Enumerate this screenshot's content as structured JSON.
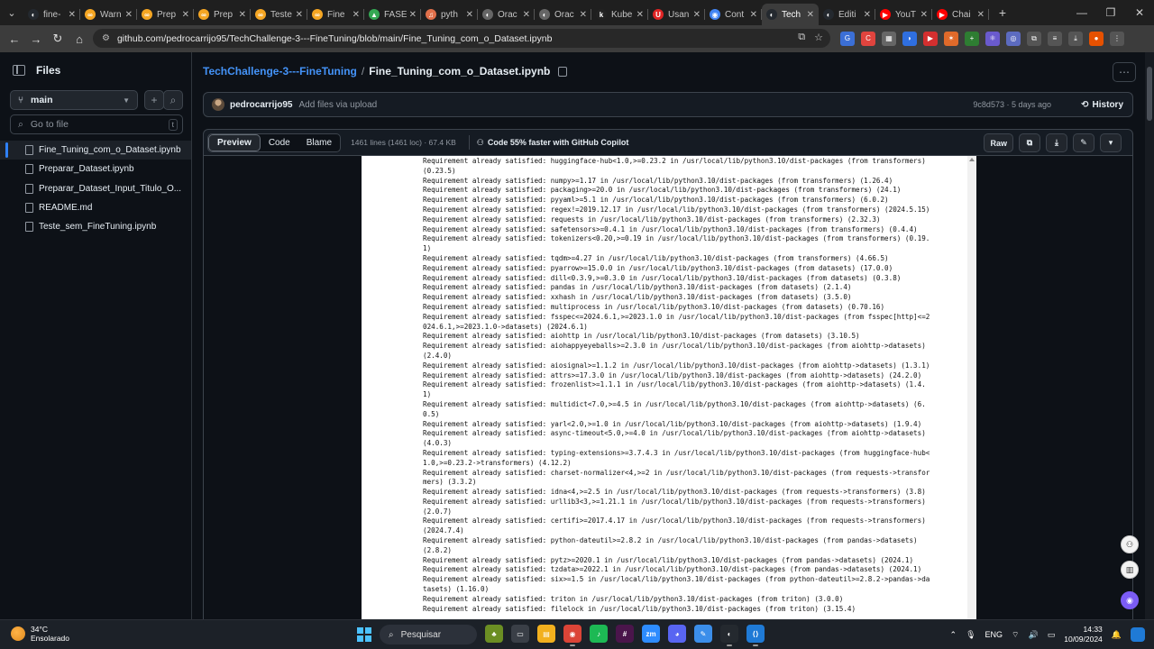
{
  "browser": {
    "tabs": [
      {
        "label": "fine-",
        "color": "#24292f",
        "glyph": "◐"
      },
      {
        "label": "Warn",
        "color": "#f5a623",
        "glyph": "∞"
      },
      {
        "label": "Prep",
        "color": "#f5a623",
        "glyph": "∞"
      },
      {
        "label": "Prep",
        "color": "#f5a623",
        "glyph": "∞"
      },
      {
        "label": "Teste",
        "color": "#f5a623",
        "glyph": "∞"
      },
      {
        "label": "Fine",
        "color": "#f5a623",
        "glyph": "∞"
      },
      {
        "label": "FASE",
        "color": "#34a853",
        "glyph": "▲"
      },
      {
        "label": "pyth",
        "color": "#e1704b",
        "glyph": "♫"
      },
      {
        "label": "Orac",
        "color": "#666666",
        "glyph": "◐"
      },
      {
        "label": "Orac",
        "color": "#666666",
        "glyph": "◐"
      },
      {
        "label": "Kube",
        "color": "#222222",
        "glyph": "k"
      },
      {
        "label": "Usan",
        "color": "#e02424",
        "glyph": "U"
      },
      {
        "label": "Cont",
        "color": "#4285f4",
        "glyph": "◉"
      },
      {
        "label": "Tech",
        "color": "#24292f",
        "glyph": "◐",
        "active": true
      },
      {
        "label": "Editi",
        "color": "#24292f",
        "glyph": "◐"
      },
      {
        "label": "YouT",
        "color": "#ff0000",
        "glyph": "▶"
      },
      {
        "label": "Chai",
        "color": "#ff0000",
        "glyph": "▶"
      }
    ],
    "close_glyph": "✕",
    "new_tab_glyph": "+",
    "url": "github.com/pedrocarrijo95/TechChallenge-3---FineTuning/blob/main/Fine_Tuning_com_o_Dataset.ipynb",
    "window_controls": {
      "minimize": "—",
      "restore": "❐",
      "close": "✕"
    },
    "nav": {
      "back": "←",
      "forward": "→",
      "reload": "↻",
      "home": "⌂"
    },
    "omni_icon": "⚙",
    "omni_actions": {
      "install": "⧉",
      "bookmark": "☆"
    },
    "extensions": [
      {
        "color": "#3b6fd6",
        "glyph": "G"
      },
      {
        "color": "#e0443e",
        "glyph": "C"
      },
      {
        "color": "#666666",
        "glyph": "▦"
      },
      {
        "color": "#2f6fe0",
        "glyph": "◗"
      },
      {
        "color": "#d32f2f",
        "glyph": "▶"
      },
      {
        "color": "#e06a2a",
        "glyph": "✶"
      },
      {
        "color": "#2e7d32",
        "glyph": "+"
      },
      {
        "color": "#6a5acd",
        "glyph": "⚛"
      },
      {
        "color": "#5c6bc0",
        "glyph": "◎"
      },
      {
        "color": "#555555",
        "glyph": "⧉"
      },
      {
        "color": "#555555",
        "glyph": "≡"
      },
      {
        "color": "#555555",
        "glyph": "⤓"
      },
      {
        "color": "#e65100",
        "glyph": "●"
      },
      {
        "color": "#555555",
        "glyph": "⋮"
      }
    ]
  },
  "sidebar": {
    "title": "Files",
    "branch": "main",
    "branch_icon": "⑂",
    "branch_caret": "▼",
    "add_glyph": "+",
    "search_glyph": "⌕",
    "goto_placeholder": "Go to file",
    "goto_shortcut": "t",
    "files": [
      {
        "name": "Fine_Tuning_com_o_Dataset.ipynb",
        "active": true
      },
      {
        "name": "Preparar_Dataset.ipynb",
        "active": false
      },
      {
        "name": "Preparar_Dataset_Input_Titulo_O...",
        "active": false
      },
      {
        "name": "README.md",
        "active": false
      },
      {
        "name": "Teste_sem_FineTuning.ipynb",
        "active": false
      }
    ]
  },
  "breadcrumb": {
    "repo": "TechChallenge-3---FineTuning",
    "separator": "/",
    "file": "Fine_Tuning_com_o_Dataset.ipynb"
  },
  "more_glyph": "⋯",
  "commit": {
    "author": "pedrocarrijo95",
    "message": "Add files via upload",
    "meta": "9c8d573 · 5 days ago",
    "history_label": "History",
    "history_icon": "⟲"
  },
  "filebar": {
    "tabs": [
      "Preview",
      "Code",
      "Blame"
    ],
    "active_tab": "Preview",
    "stats": "1461 lines (1461 loc) · 67.4 KB",
    "copilot_icon": "⚇",
    "copilot": "Code 55% faster with GitHub Copilot",
    "actions": {
      "raw": "Raw",
      "copy": "⧉",
      "download": "⤓",
      "edit": "✎",
      "more": "▾"
    }
  },
  "notebook_output": [
    "Requirement already satisfied: huggingface-hub<1.0,>=0.23.2 in /usr/local/lib/python3.10/dist-packages (from transformers)",
    "(0.23.5)",
    "Requirement already satisfied: numpy>=1.17 in /usr/local/lib/python3.10/dist-packages (from transformers) (1.26.4)",
    "Requirement already satisfied: packaging>=20.0 in /usr/local/lib/python3.10/dist-packages (from transformers) (24.1)",
    "Requirement already satisfied: pyyaml>=5.1 in /usr/local/lib/python3.10/dist-packages (from transformers) (6.0.2)",
    "Requirement already satisfied: regex!=2019.12.17 in /usr/local/lib/python3.10/dist-packages (from transformers) (2024.5.15)",
    "Requirement already satisfied: requests in /usr/local/lib/python3.10/dist-packages (from transformers) (2.32.3)",
    "Requirement already satisfied: safetensors>=0.4.1 in /usr/local/lib/python3.10/dist-packages (from transformers) (0.4.4)",
    "Requirement already satisfied: tokenizers<0.20,>=0.19 in /usr/local/lib/python3.10/dist-packages (from transformers) (0.19.",
    "1)",
    "Requirement already satisfied: tqdm>=4.27 in /usr/local/lib/python3.10/dist-packages (from transformers) (4.66.5)",
    "Requirement already satisfied: pyarrow>=15.0.0 in /usr/local/lib/python3.10/dist-packages (from datasets) (17.0.0)",
    "Requirement already satisfied: dill<0.3.9,>=0.3.0 in /usr/local/lib/python3.10/dist-packages (from datasets) (0.3.8)",
    "Requirement already satisfied: pandas in /usr/local/lib/python3.10/dist-packages (from datasets) (2.1.4)",
    "Requirement already satisfied: xxhash in /usr/local/lib/python3.10/dist-packages (from datasets) (3.5.0)",
    "Requirement already satisfied: multiprocess in /usr/local/lib/python3.10/dist-packages (from datasets) (0.70.16)",
    "Requirement already satisfied: fsspec<=2024.6.1,>=2023.1.0 in /usr/local/lib/python3.10/dist-packages (from fsspec[http]<=2",
    "024.6.1,>=2023.1.0->datasets) (2024.6.1)",
    "Requirement already satisfied: aiohttp in /usr/local/lib/python3.10/dist-packages (from datasets) (3.10.5)",
    "Requirement already satisfied: aiohappyeyeballs>=2.3.0 in /usr/local/lib/python3.10/dist-packages (from aiohttp->datasets)",
    "(2.4.0)",
    "Requirement already satisfied: aiosignal>=1.1.2 in /usr/local/lib/python3.10/dist-packages (from aiohttp->datasets) (1.3.1)",
    "Requirement already satisfied: attrs>=17.3.0 in /usr/local/lib/python3.10/dist-packages (from aiohttp->datasets) (24.2.0)",
    "Requirement already satisfied: frozenlist>=1.1.1 in /usr/local/lib/python3.10/dist-packages (from aiohttp->datasets) (1.4.",
    "1)",
    "Requirement already satisfied: multidict<7.0,>=4.5 in /usr/local/lib/python3.10/dist-packages (from aiohttp->datasets) (6.",
    "0.5)",
    "Requirement already satisfied: yarl<2.0,>=1.0 in /usr/local/lib/python3.10/dist-packages (from aiohttp->datasets) (1.9.4)",
    "Requirement already satisfied: async-timeout<5.0,>=4.0 in /usr/local/lib/python3.10/dist-packages (from aiohttp->datasets)",
    "(4.0.3)",
    "Requirement already satisfied: typing-extensions>=3.7.4.3 in /usr/local/lib/python3.10/dist-packages (from huggingface-hub<",
    "1.0,>=0.23.2->transformers) (4.12.2)",
    "Requirement already satisfied: charset-normalizer<4,>=2 in /usr/local/lib/python3.10/dist-packages (from requests->transfor",
    "mers) (3.3.2)",
    "Requirement already satisfied: idna<4,>=2.5 in /usr/local/lib/python3.10/dist-packages (from requests->transformers) (3.8)",
    "Requirement already satisfied: urllib3<3,>=1.21.1 in /usr/local/lib/python3.10/dist-packages (from requests->transformers)",
    "(2.0.7)",
    "Requirement already satisfied: certifi>=2017.4.17 in /usr/local/lib/python3.10/dist-packages (from requests->transformers)",
    "(2024.7.4)",
    "Requirement already satisfied: python-dateutil>=2.8.2 in /usr/local/lib/python3.10/dist-packages (from pandas->datasets)",
    "(2.8.2)",
    "Requirement already satisfied: pytz>=2020.1 in /usr/local/lib/python3.10/dist-packages (from pandas->datasets) (2024.1)",
    "Requirement already satisfied: tzdata>=2022.1 in /usr/local/lib/python3.10/dist-packages (from pandas->datasets) (2024.1)",
    "Requirement already satisfied: six>=1.5 in /usr/local/lib/python3.10/dist-packages (from python-dateutil>=2.8.2->pandas->da",
    "tasets) (1.16.0)",
    "Requirement already satisfied: triton in /usr/local/lib/python3.10/dist-packages (from triton) (3.0.0)",
    "Requirement already satisfied: filelock in /usr/local/lib/python3.10/dist-packages (from triton) (3.15.4)"
  ],
  "float_buttons": [
    "⚇",
    "▥",
    "◉"
  ],
  "taskbar": {
    "temperature": "34°C",
    "weather": "Ensolarado",
    "search_placeholder": "Pesquisar",
    "search_glyph": "⌕",
    "apps": [
      {
        "name": "widgets",
        "color": "#6b8e23",
        "glyph": "♣"
      },
      {
        "name": "task-view",
        "color": "#3a3f47",
        "glyph": "▭"
      },
      {
        "name": "file-explorer",
        "color": "#f2b01e",
        "glyph": "▤"
      },
      {
        "name": "chrome",
        "color": "#db4437",
        "glyph": "◉",
        "running": true
      },
      {
        "name": "spotify",
        "color": "#1db954",
        "glyph": "♪"
      },
      {
        "name": "slack",
        "color": "#4a154b",
        "glyph": "#"
      },
      {
        "name": "zoom",
        "color": "#2d8cff",
        "glyph": "zm"
      },
      {
        "name": "discord",
        "color": "#5865f2",
        "glyph": "◕"
      },
      {
        "name": "notepad",
        "color": "#3b8eea",
        "glyph": "✎"
      },
      {
        "name": "github-desktop",
        "color": "#24292f",
        "glyph": "◐",
        "running": true
      },
      {
        "name": "vscode",
        "color": "#1f7ad6",
        "glyph": "⟨⟩",
        "running": true
      }
    ],
    "tray": {
      "chevron": "⌃",
      "mic": "🎙",
      "language": "ENG",
      "network": "⌔",
      "volume": "🔊",
      "battery": "▭",
      "time": "14:33",
      "date": "10/09/2024",
      "bell": "🔔"
    }
  }
}
